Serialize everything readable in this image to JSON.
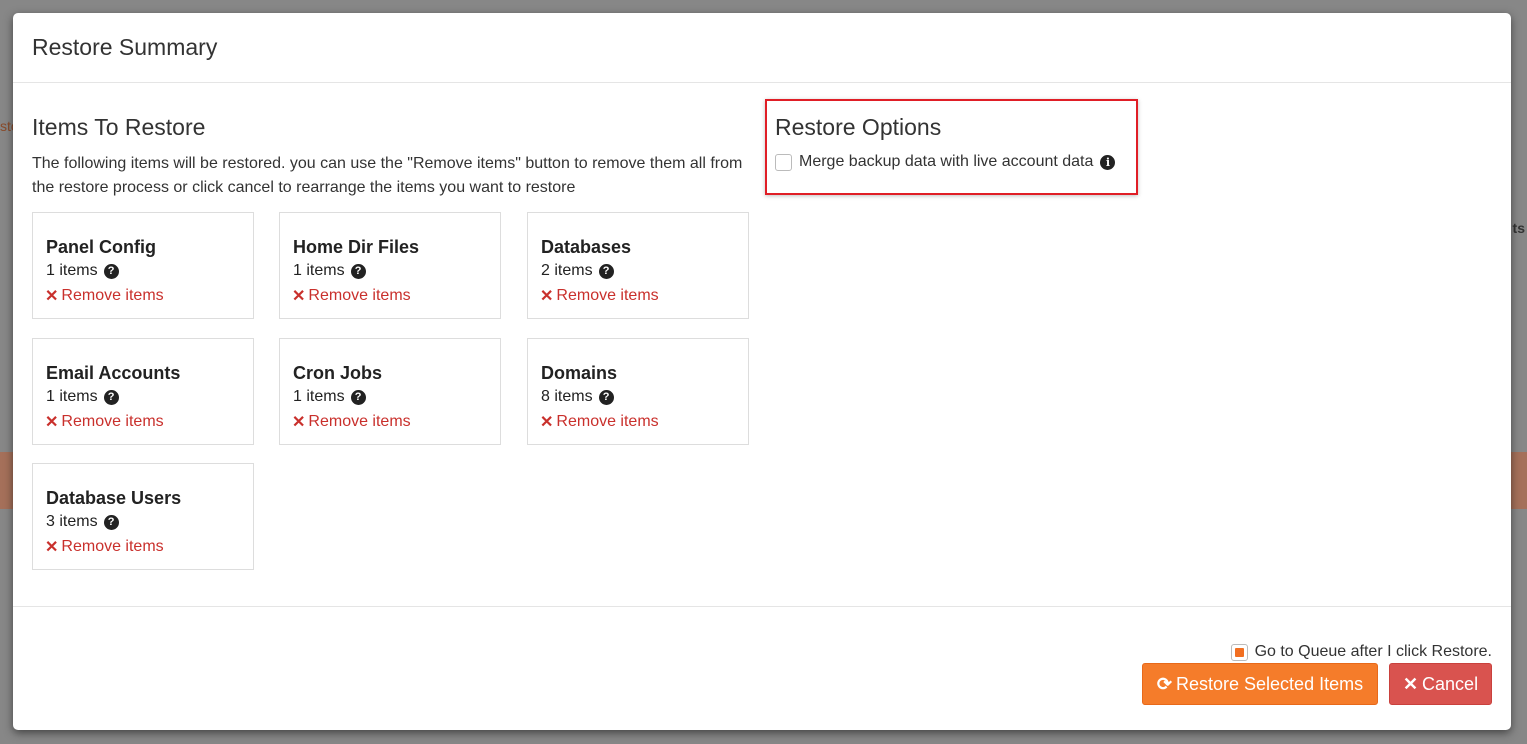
{
  "modal": {
    "title": "Restore Summary"
  },
  "items_section": {
    "title": "Items To Restore",
    "intro": "The following items will be restored. you can use the \"Remove items\" button to remove them all from the restore process or click cancel to rearrange the items you want to restore",
    "remove_label": "Remove items",
    "cards": [
      {
        "title": "Panel Config",
        "count": "1 items"
      },
      {
        "title": "Home Dir Files",
        "count": "1 items"
      },
      {
        "title": "Databases",
        "count": "2 items"
      },
      {
        "title": "Email Accounts",
        "count": "1 items"
      },
      {
        "title": "Cron Jobs",
        "count": "1 items"
      },
      {
        "title": "Domains",
        "count": "8 items"
      },
      {
        "title": "Database Users",
        "count": "3 items"
      }
    ]
  },
  "options_section": {
    "title": "Restore Options",
    "merge_label": "Merge backup data with live account data",
    "merge_checked": false
  },
  "footer": {
    "queue_label": "Go to Queue after I click Restore.",
    "queue_checked": true,
    "restore_button": "Restore Selected Items",
    "cancel_button": "Cancel"
  },
  "background": {
    "left_fragment": "sto",
    "right_fragment": "ts"
  },
  "colors": {
    "restore_button": "#f57c2a",
    "cancel_button": "#d9534f",
    "remove_link": "#c9302c",
    "highlight_box": "#e01e26"
  },
  "icons": {
    "help": "question-circle-icon",
    "remove": "times-icon",
    "info": "info-circle-icon",
    "restore": "refresh-icon",
    "cancel": "times-icon"
  }
}
